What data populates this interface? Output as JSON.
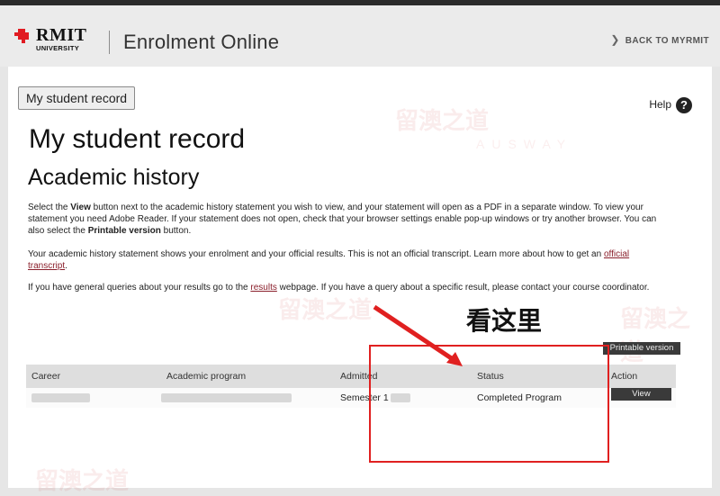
{
  "header": {
    "logo_text": "RMIT",
    "logo_sub": "UNIVERSITY",
    "app_title": "Enrolment Online",
    "back_link": "BACK TO MYRMIT"
  },
  "nav": {
    "record_button": "My student record"
  },
  "help": {
    "label": "Help",
    "icon": "?"
  },
  "page": {
    "title": "My student record",
    "subtitle": "Academic history",
    "para1_a": "Select the ",
    "para1_b": "View",
    "para1_c": " button next to the academic history statement you wish to view, and your statement will open as a PDF in a separate window. To view your statement you need Adobe Reader. If your statement does not open, check that your browser settings enable pop-up windows or try another browser. You can also select the ",
    "para1_d": "Printable version",
    "para1_e": " button.",
    "para2_a": "Your academic history statement shows your enrolment and your official results. This is not an official transcript. Learn more about how to get an ",
    "para2_link": "official transcript",
    "para2_b": ".",
    "para3_a": "If you have general queries about your results go to the ",
    "para3_link": "results",
    "para3_b": " webpage. If you have a query about a specific result, please contact your course coordinator."
  },
  "printable_button": "Printable version",
  "table": {
    "headers": [
      "Career",
      "Academic program",
      "Admitted",
      "Status",
      "Action"
    ],
    "row": {
      "admitted": "Semester 1",
      "status": "Completed Program",
      "action": "View"
    }
  },
  "annotation": {
    "text": "看这里",
    "color": "#e02020"
  },
  "watermark": {
    "text": "留澳之道",
    "sub": "AUSWAY"
  }
}
